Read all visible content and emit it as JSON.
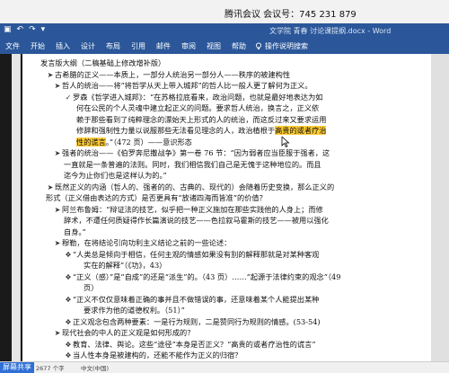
{
  "meeting": {
    "label": "腾讯会议 会议号：745 231 879"
  },
  "titlebar": {
    "quick_access": [
      "▣",
      "↶",
      "↷",
      "▾"
    ],
    "doc_title": "文学院 青春 讨论课提纲.docx - Word"
  },
  "ribbon": {
    "tabs": [
      "文件",
      "开始",
      "插入",
      "设计",
      "布局",
      "引用",
      "邮件",
      "审阅",
      "视图",
      "帮助"
    ],
    "tell_me": "操作说明搜索"
  },
  "document": {
    "lines": [
      {
        "level": "l0",
        "bullet": "",
        "text": "发言版大纲（二稿基础上修改增补版）"
      },
      {
        "level": "l1",
        "bullet": "➤",
        "text": "古希腊的正义——本质上，一部分人统治另一部分人——秩序的被建构性"
      },
      {
        "level": "l2",
        "bullet": "➤",
        "text": "哲人的统治——将“将哲学从天上带入城邦”的哲人比一般人更了解何为正义。"
      },
      {
        "level": "l3",
        "bullet": "✓",
        "text": "罗森《哲学进入城邦》：“在苏格拉底看来，政治问题，也就是最好地表达为如"
      },
      {
        "level": "c3",
        "bullet": "",
        "text": "何在公民的个人灵魂中建立起正义的问题。要求哲人统治，换言之，正义依"
      },
      {
        "level": "c3",
        "bullet": "",
        "text": "赖于那些看到了纯粹理念的漂始天上形式的人的统治，而这反过来又要求运用"
      },
      {
        "level": "c3",
        "bullet": "",
        "text": "修辞和强制性力量以说服那些无法看见理念的人，政治植根于",
        "hl": "高贵的或者疗治"
      },
      {
        "level": "c3",
        "bullet": "",
        "hl2": "性的谎言",
        "text2": "。”（472 页）——意识形态"
      },
      {
        "level": "l2",
        "bullet": "➤",
        "text": "强者的统治——《伯罗奔尼撒战争》第一卷 76 节：“因为弱者应当臣服于强者，这"
      },
      {
        "level": "c2",
        "bullet": "",
        "text": "一直就是一条普遍的法则。同时，我们相信我们自己是无愧于这种地位的。而且"
      },
      {
        "level": "c2",
        "bullet": "",
        "text": "迄今为止你们也是这样认为的。”"
      },
      {
        "level": "l1",
        "bullet": "➤",
        "text": "既然正义的内涵（哲人的、强者的的、古典的、现代的）会随着历史变换，那么正义的"
      },
      {
        "level": "c1",
        "bullet": "",
        "text": "形式（正义借由表达的方式）是否更具有“放诸四海而皆准”的价值？"
      },
      {
        "level": "l2",
        "bullet": "➤",
        "text": "阿兰布鲁姆：“辩证法的技艺，似乎把一种正义施加在那些实践他的人身上；而修"
      },
      {
        "level": "c2",
        "bullet": "",
        "text": "辞术，不遭任何质疑得作长篇演说的技艺——色拉叙马霍斯的技艺——被用以强化"
      },
      {
        "level": "c2",
        "bullet": "",
        "text": "自身。”"
      },
      {
        "level": "l2",
        "bullet": "➤",
        "text": "穆勒，在将结论引向功利主义结论之前的一些论述："
      },
      {
        "level": "l3",
        "bullet": "❖",
        "text": "“人类总是倾向于相信，任何主观的情感如果没有别的解释那就是对某种客观"
      },
      {
        "level": "c4",
        "bullet": "",
        "text": "实在的解释”（《功》，43）"
      },
      {
        "level": "l3",
        "bullet": "❖",
        "text": "“正义（感）”是“自成”的还是“派生”的。（43 页）……“起源于法律约束的观念”（49"
      },
      {
        "level": "c4",
        "bullet": "",
        "text": "页）"
      },
      {
        "level": "l3",
        "bullet": "❖",
        "text": "“正义不仅仅意味着正确的事并且不做错误的事，还意味着某个人能提出某种"
      },
      {
        "level": "c4",
        "bullet": "",
        "text": "要求作为他的道德权利。（51）”"
      },
      {
        "level": "l3",
        "bullet": "❖",
        "text": "正义观念包含两种要素：一是行为规则，二是赞同行为规则的情感。(53-54)"
      },
      {
        "level": "l2",
        "bullet": "➤",
        "text": "现代社会的中人的正义观是如何形成的？"
      },
      {
        "level": "l3",
        "bullet": "❖",
        "text": "教育、法律、舆论。这些“途径”本身是否正义？“高贵的或者疗治性的谎言”"
      },
      {
        "level": "l3",
        "bullet": "❖",
        "text": "当人性本身是被建构的，还能不能作为正义的归宿？"
      }
    ]
  },
  "status": {
    "share_label": "屏幕共享",
    "words": "2677 个字",
    "language": "中文(中国)"
  }
}
